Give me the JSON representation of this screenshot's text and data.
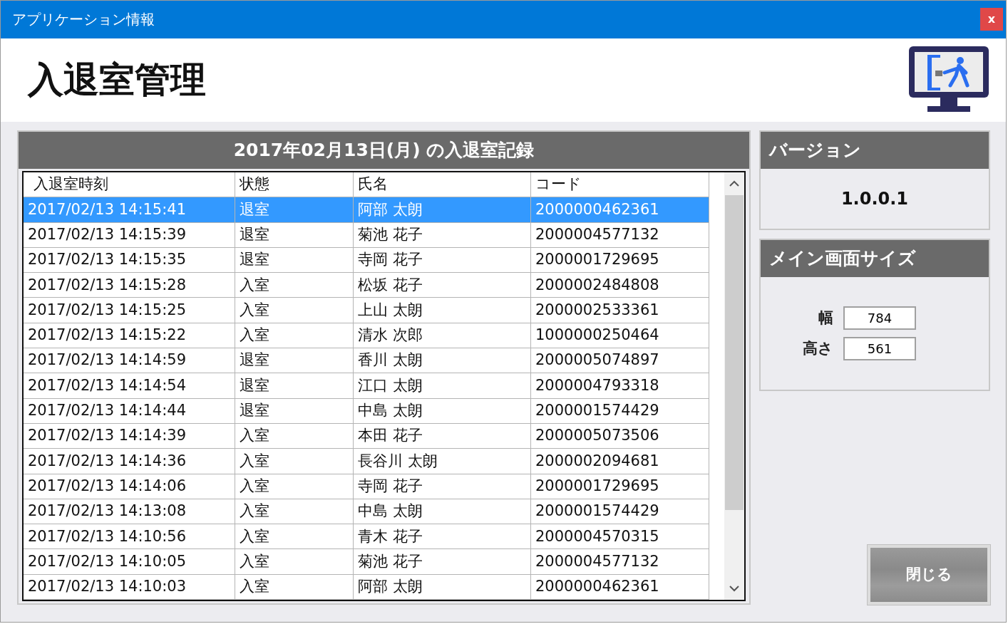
{
  "window": {
    "title": "アプリケーション情報",
    "close_label": "x"
  },
  "header": {
    "title": "入退室管理"
  },
  "log_panel": {
    "title": "2017年02月13日(月) の入退室記録",
    "table": {
      "columns": [
        "入退室時刻",
        "状態",
        "氏名",
        "コード"
      ],
      "rows": [
        {
          "cells": [
            "2017/02/13 14:15:41",
            "退室",
            "阿部 太朗",
            "2000000462361"
          ],
          "selected": true
        },
        {
          "cells": [
            "2017/02/13 14:15:39",
            "退室",
            "菊池 花子",
            "2000004577132"
          ],
          "selected": false
        },
        {
          "cells": [
            "2017/02/13 14:15:35",
            "退室",
            "寺岡 花子",
            "2000001729695"
          ],
          "selected": false
        },
        {
          "cells": [
            "2017/02/13 14:15:28",
            "入室",
            "松坂 花子",
            "2000002484808"
          ],
          "selected": false
        },
        {
          "cells": [
            "2017/02/13 14:15:25",
            "入室",
            "上山 太朗",
            "2000002533361"
          ],
          "selected": false
        },
        {
          "cells": [
            "2017/02/13 14:15:22",
            "入室",
            "清水 次郎",
            "1000000250464"
          ],
          "selected": false
        },
        {
          "cells": [
            "2017/02/13 14:14:59",
            "退室",
            "香川 太朗",
            "2000005074897"
          ],
          "selected": false
        },
        {
          "cells": [
            "2017/02/13 14:14:54",
            "退室",
            "江口 太朗",
            "2000004793318"
          ],
          "selected": false
        },
        {
          "cells": [
            "2017/02/13 14:14:44",
            "退室",
            "中島 太朗",
            "2000001574429"
          ],
          "selected": false
        },
        {
          "cells": [
            "2017/02/13 14:14:39",
            "入室",
            "本田 花子",
            "2000005073506"
          ],
          "selected": false
        },
        {
          "cells": [
            "2017/02/13 14:14:36",
            "入室",
            "長谷川 太朗",
            "2000002094681"
          ],
          "selected": false
        },
        {
          "cells": [
            "2017/02/13 14:14:06",
            "入室",
            "寺岡 花子",
            "2000001729695"
          ],
          "selected": false
        },
        {
          "cells": [
            "2017/02/13 14:13:08",
            "入室",
            "中島 太朗",
            "2000001574429"
          ],
          "selected": false
        },
        {
          "cells": [
            "2017/02/13 14:10:56",
            "入室",
            "青木 花子",
            "2000004570315"
          ],
          "selected": false
        },
        {
          "cells": [
            "2017/02/13 14:10:05",
            "入室",
            "菊池 花子",
            "2000004577132"
          ],
          "selected": false
        },
        {
          "cells": [
            "2017/02/13 14:10:03",
            "入室",
            "阿部 太朗",
            "2000000462361"
          ],
          "selected": false
        }
      ]
    }
  },
  "version_panel": {
    "title": "バージョン",
    "value": "1.0.0.1"
  },
  "size_panel": {
    "title": "メイン画面サイズ",
    "fields": [
      {
        "label": "幅",
        "value": "784"
      },
      {
        "label": "高さ",
        "value": "561"
      }
    ]
  },
  "close_button": {
    "label": "閉じる"
  }
}
